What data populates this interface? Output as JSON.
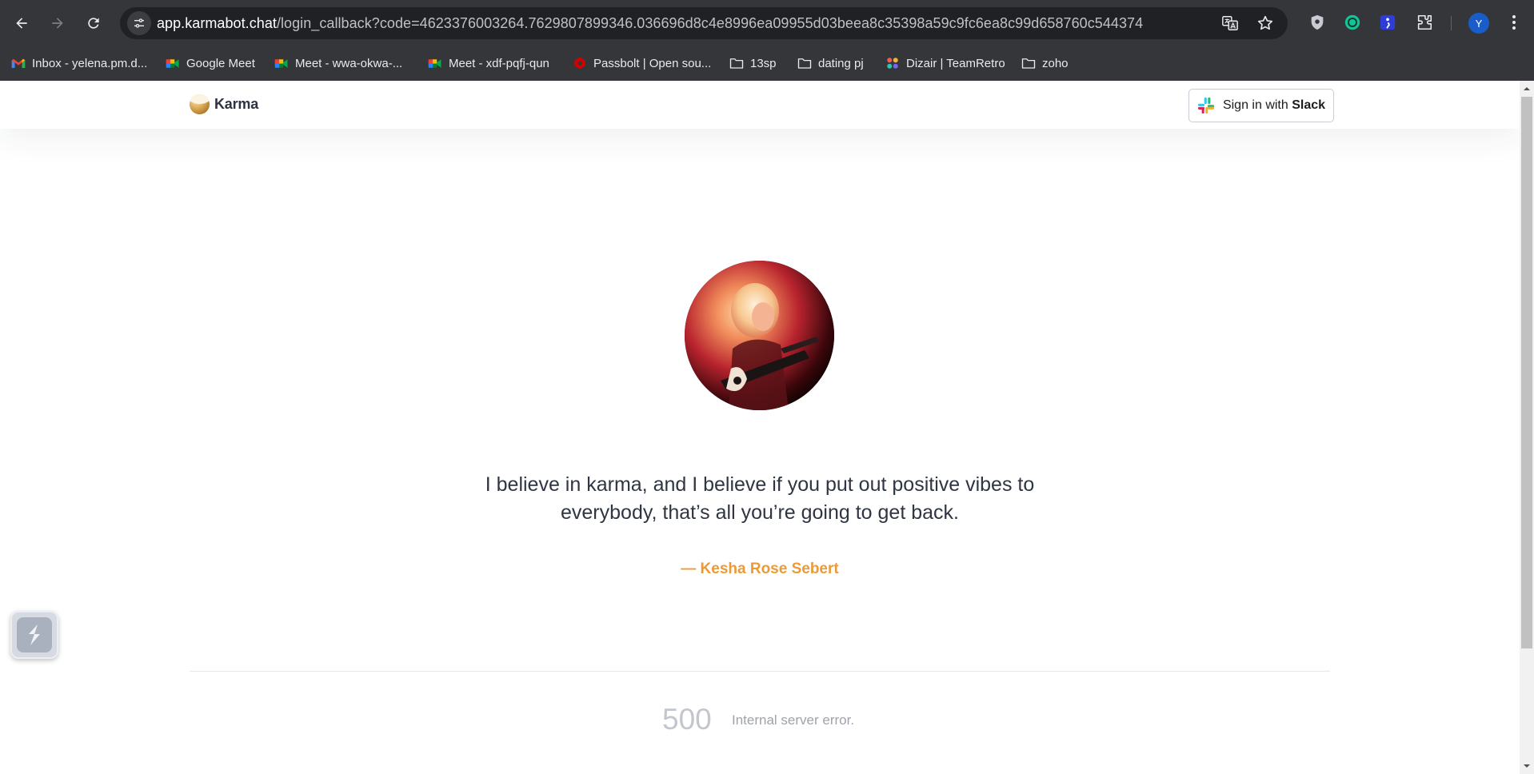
{
  "browser": {
    "url_host": "app.karmabot.chat",
    "url_path": "/login_callback?code=4623376003264.7629807899346.036696d8c4e8996ea09955d03beea8c35398a59c9fc6ea8c99d658760c544374",
    "profile_initial": "Y",
    "bookmarks": [
      {
        "label": "Inbox - yelena.pm.d...",
        "icon": "gmail-icon"
      },
      {
        "label": "Google Meet",
        "icon": "meet-icon"
      },
      {
        "label": "Meet - wwa-okwa-...",
        "icon": "meet-icon"
      },
      {
        "label": "Meet - xdf-pqfj-qun",
        "icon": "meet-icon"
      },
      {
        "label": "Passbolt | Open sou...",
        "icon": "passbolt-icon"
      },
      {
        "label": "13sp",
        "icon": "folder-icon"
      },
      {
        "label": "dating pj",
        "icon": "folder-icon"
      },
      {
        "label": "Dizair | TeamRetro",
        "icon": "teamretro-icon"
      },
      {
        "label": "zoho",
        "icon": "folder-icon"
      }
    ]
  },
  "header": {
    "logo_text": "Karma",
    "signin_prefix": "Sign in with",
    "signin_brand": "Slack"
  },
  "main": {
    "quote_line1": "I believe in karma, and I believe if you put out positive vibes to",
    "quote_line2": "everybody, that’s all you’re going to get back.",
    "author": "— Kesha Rose Sebert"
  },
  "footer": {
    "error_code": "500",
    "error_message": "Internal server error."
  },
  "colors": {
    "accent": "#ed9a35",
    "text": "#2f3542",
    "chrome_bg": "#35363a"
  }
}
